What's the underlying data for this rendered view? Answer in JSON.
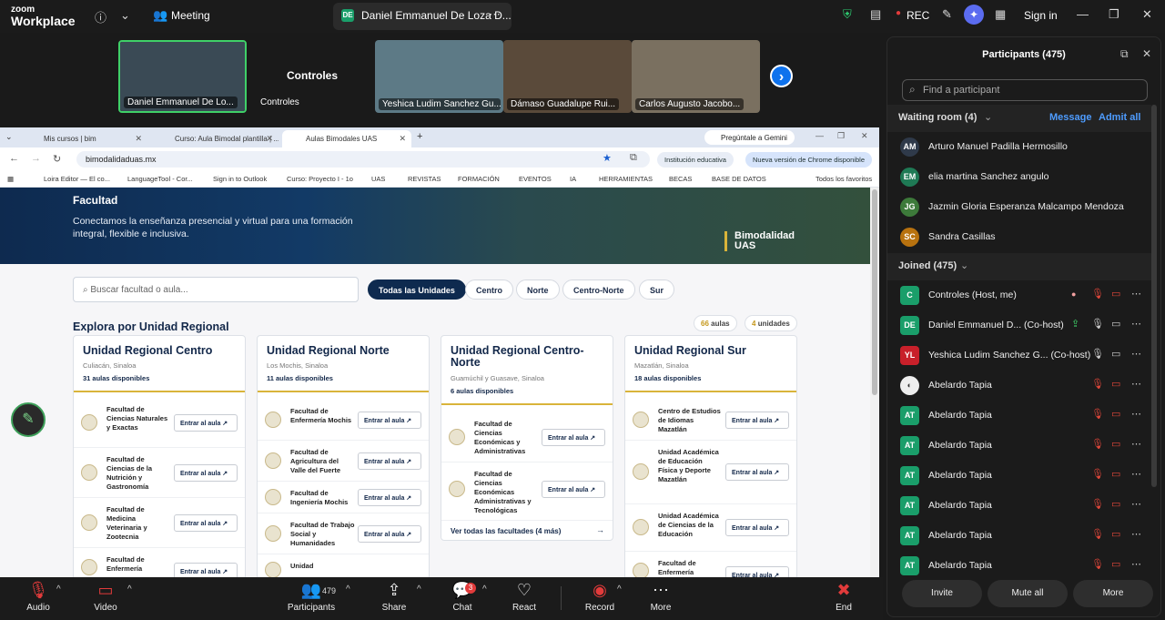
{
  "topbar": {
    "logo_line1": "zoom",
    "logo_line2": "Workplace",
    "meeting_label": "Meeting",
    "host_badge": "DE",
    "host_tab": "Daniel Emmanuel De Loza D...",
    "rec_label": "REC",
    "sign_in": "Sign in"
  },
  "strip": {
    "tiles": [
      {
        "name": "Daniel Emmanuel De Lo...",
        "bg": "#3a4a55"
      },
      {
        "name": "Controles",
        "bg": "#1a1a1a"
      },
      {
        "name": "Yeshica Ludim Sanchez Gu...",
        "bg": "#5d7a86"
      },
      {
        "name": "Dámaso Guadalupe Rui...",
        "bg": "#5a4a3a"
      },
      {
        "name": "Carlos Augusto Jacobo...",
        "bg": "#7a7060"
      }
    ],
    "controles_title": "Controles"
  },
  "browser": {
    "tabs": [
      "Mis cursos | bim",
      "Curso: Aula Bimodal plantilla | ...",
      "Aulas Bimodales UAS"
    ],
    "gemini": "Pregúntale a Gemini",
    "url": "bimodalidaduas.mx",
    "profile_chip": "Institución educativa",
    "update_chip": "Nueva versión de Chrome disponible",
    "bookmarks": [
      "Loira Editor — El co...",
      "LanguageTool - Cor...",
      "Sign in to Outlook",
      "Curso: Proyecto I - 1o",
      "UAS",
      "REVISTAS",
      "FORMACIÓN",
      "EVENTOS",
      "IA",
      "HERRAMIENTAS",
      "BECAS",
      "BASE DE DATOS",
      "Todos los favoritos"
    ]
  },
  "site": {
    "hero_title": "Facultad",
    "hero_sub": "Conectamos la enseñanza presencial y virtual para una formación integral, flexible e inclusiva.",
    "hero_badge_1": "Bimodalidad",
    "hero_badge_2": "UAS",
    "search_placeholder": "Buscar facultad o aula...",
    "filters": [
      "Todas las Unidades",
      "Centro",
      "Norte",
      "Centro-Norte",
      "Sur"
    ],
    "section_title": "Explora por Unidad Regional",
    "count_aulas_num": "66",
    "count_aulas_label": "aulas",
    "count_unid_num": "4",
    "count_unid_label": "unidades",
    "enter_label": "Entrar al aula",
    "cards": [
      {
        "title": "Unidad Regional Centro",
        "loc": "Culiacán, Sinaloa",
        "avail": "31 aulas disponibles",
        "facs": [
          "Facultad de Ciencias Naturales y Exactas",
          "Facultad de Ciencias de la Nutrición y Gastronomía",
          "Facultad de Medicina Veterinaria y Zootecnia",
          "Facultad de Enfermería"
        ]
      },
      {
        "title": "Unidad Regional Norte",
        "loc": "Los Mochis, Sinaloa",
        "avail": "11 aulas disponibles",
        "facs": [
          "Facultad de Enfermería Mochis",
          "Facultad de Agricultura del Valle del Fuerte",
          "Facultad de Ingeniería Mochis",
          "Facultad de Trabajo Social y Humanidades",
          "Unidad"
        ]
      },
      {
        "title": "Unidad Regional Centro-Norte",
        "loc": "Guamúchil y Guasave, Sinaloa",
        "avail": "6 aulas disponibles",
        "facs": [
          "Facultad de Ciencias Económicas y Administrativas",
          "Facultad de Ciencias Económicas Administrativas y Tecnológicas"
        ],
        "more": "Ver todas las facultades (4 más)"
      },
      {
        "title": "Unidad Regional Sur",
        "loc": "Mazatlán, Sinaloa",
        "avail": "18 aulas disponibles",
        "facs": [
          "Centro de Estudios de Idiomas Mazatlán",
          "Unidad Académica de Educación Física y Deporte Mazatlán",
          "Unidad Académica de Ciencias de la Educación",
          "Facultad de Enfermería"
        ]
      }
    ]
  },
  "panel": {
    "title": "Participants (475)",
    "search_placeholder": "Find a participant",
    "waiting_title": "Waiting room (4)",
    "message": "Message",
    "admit_all": "Admit all",
    "waiting": [
      {
        "initials": "AM",
        "name": "Arturo Manuel Padilla Hermosillo",
        "color": "#2f3a4a"
      },
      {
        "initials": "EM",
        "name": "elia martina Sanchez angulo",
        "color": "#1f7a55"
      },
      {
        "initials": "JG",
        "name": "Jazmin Gloria Esperanza Malcampo Mendoza",
        "color": "#3d7a3a"
      },
      {
        "initials": "SC",
        "name": "Sandra Casillas",
        "color": "#b8720f"
      }
    ],
    "joined_title": "Joined (475)",
    "joined": [
      {
        "initials": "C",
        "name": "Controles (Host, me)",
        "color": "#1a9e6a"
      },
      {
        "initials": "DE",
        "name": "Daniel Emmanuel D...  (Co-host)",
        "color": "#1a9e6a"
      },
      {
        "initials": "YL",
        "name": "Yeshica Ludim Sanchez G...  (Co-host)",
        "color": "#c8202a"
      },
      {
        "initials": "",
        "name": "Abelardo Tapia",
        "color": "#666"
      },
      {
        "initials": "AT",
        "name": "Abelardo Tapia",
        "color": "#1a9e6a"
      },
      {
        "initials": "AT",
        "name": "Abelardo Tapia",
        "color": "#1a9e6a"
      },
      {
        "initials": "AT",
        "name": "Abelardo Tapia",
        "color": "#1a9e6a"
      },
      {
        "initials": "AT",
        "name": "Abelardo Tapia",
        "color": "#1a9e6a"
      },
      {
        "initials": "AT",
        "name": "Abelardo Tapia",
        "color": "#1a9e6a"
      },
      {
        "initials": "AT",
        "name": "Abelardo Tapia",
        "color": "#1a9e6a"
      }
    ],
    "invite": "Invite",
    "mute_all": "Mute all",
    "more": "More"
  },
  "bottombar": {
    "audio": "Audio",
    "video": "Video",
    "participants": "Participants",
    "participants_count": "479",
    "share": "Share",
    "chat": "Chat",
    "chat_badge": "3",
    "react": "React",
    "record": "Record",
    "more": "More",
    "end": "End"
  }
}
